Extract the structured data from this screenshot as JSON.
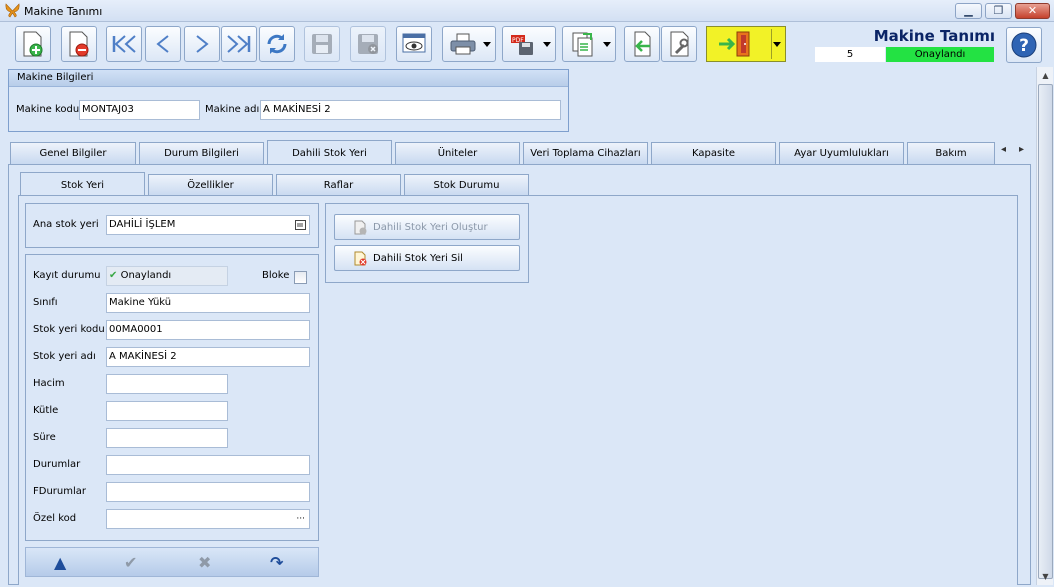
{
  "window": {
    "title": "Makine Tanımı",
    "minimize": "▁",
    "restore": "❐",
    "close": "✕"
  },
  "header": {
    "title": "Makine Tanımı",
    "record_no": "5",
    "status": "Onaylandı"
  },
  "machine_info": {
    "group_title": "Makine Bilgileri",
    "code_label": "Makine kodu",
    "code_value": "MONTAJ03",
    "name_label": "Makine adı",
    "name_value": "A MAKİNESİ 2"
  },
  "main_tabs": [
    "Genel Bilgiler",
    "Durum Bilgileri",
    "Dahili Stok Yeri",
    "Üniteler",
    "Veri Toplama Cihazları",
    "Kapasite",
    "Ayar Uyumlulukları",
    "Bakım"
  ],
  "tab_scroll": {
    "left": "◂",
    "right": "▸"
  },
  "sub_tabs": [
    "Stok Yeri",
    "Özellikler",
    "Raflar",
    "Stok Durumu"
  ],
  "stock": {
    "main_label": "Ana stok yeri",
    "main_value": "DAHİLİ İŞLEM",
    "status_label": "Kayıt durumu",
    "status_value": "Onaylandı",
    "block_label": "Bloke",
    "class_label": "Sınıfı",
    "class_value": "Makine Yükü",
    "code_label": "Stok yeri kodu",
    "code_value": "00MA0001",
    "name_label": "Stok yeri adı",
    "name_value": "A MAKİNESİ 2",
    "volume_label": "Hacim",
    "volume_value": "",
    "mass_label": "Kütle",
    "mass_value": "",
    "duration_label": "Süre",
    "duration_value": "",
    "states_label": "Durumlar",
    "states_value": "",
    "fstates_label": "FDurumlar",
    "fstates_value": "",
    "special_label": "Özel kod",
    "special_value": "",
    "ellipsis": "···"
  },
  "actions": {
    "create": "Dahili Stok Yeri Oluştur",
    "delete": "Dahili Stok Yeri Sil"
  },
  "nav": {
    "up": "▲",
    "ok": "✔",
    "cancel": "✖",
    "redo": "↷"
  },
  "scroll": {
    "up": "▲",
    "down": "▼"
  }
}
